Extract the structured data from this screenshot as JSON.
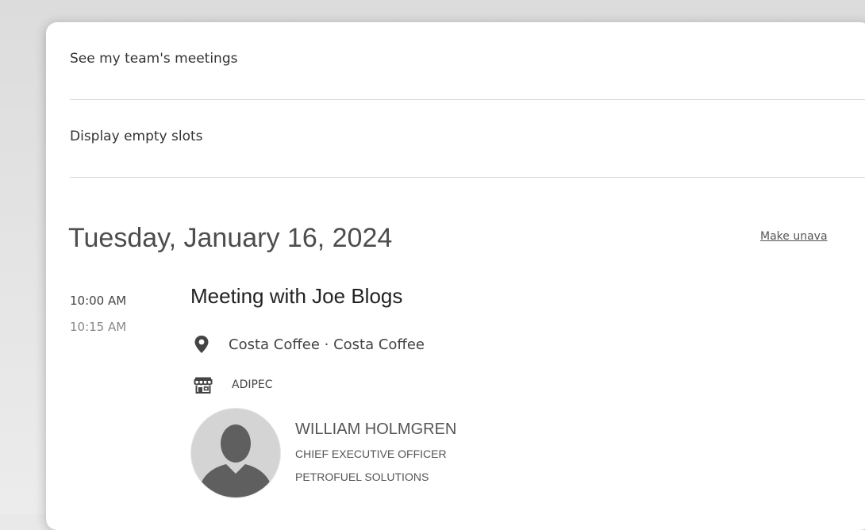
{
  "options": {
    "team_meetings_label": "See my team's meetings",
    "empty_slots_label": "Display empty slots"
  },
  "day": {
    "date_heading": "Tuesday, January 16, 2024",
    "make_unavailable_label": "Make unava"
  },
  "meeting": {
    "start_time": "10:00 AM",
    "end_time": "10:15 AM",
    "title": "Meeting with Joe Blogs",
    "location": "Costa Coffee · Costa Coffee",
    "event": "ADIPEC",
    "location_icon": "map-pin-icon",
    "event_icon": "store-icon",
    "attendee": {
      "name": "WILLIAM HOLMGREN",
      "title": "CHIEF EXECUTIVE OFFICER",
      "company": "PETROFUEL SOLUTIONS",
      "avatar_icon": "person-silhouette-icon"
    }
  },
  "colors": {
    "avatar_bg": "#d4d4d4",
    "avatar_silhouette": "#5f5f5f",
    "icon_color": "#444444"
  }
}
